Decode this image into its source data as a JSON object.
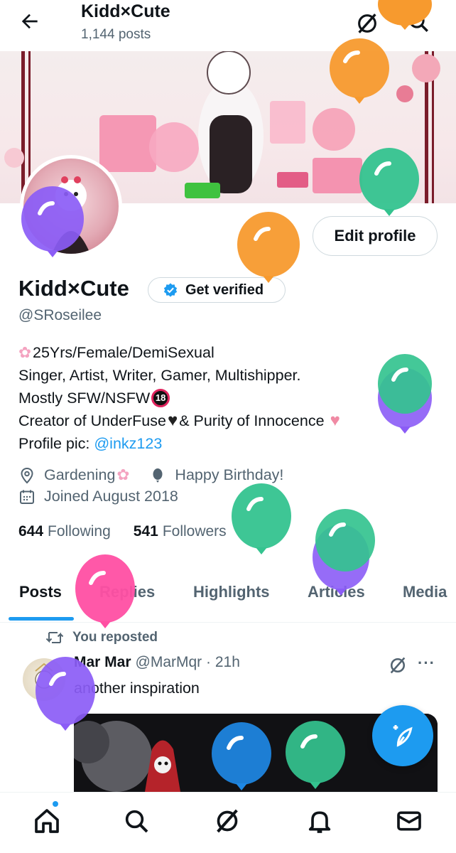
{
  "header": {
    "title": "Kidd×Cute",
    "post_count": "1,144 posts"
  },
  "profile": {
    "display_name": "Kidd×Cute",
    "handle": "@SRoseilee",
    "edit_profile_label": "Edit profile",
    "get_verified_label": "Get verified",
    "bio": {
      "line1": "25Yrs/Female/DemiSexual",
      "line2": "Singer, Artist, Writer, Gamer, Multishipper.",
      "line3": "Mostly SFW/NSFW",
      "line4_a": "Creator of UnderFuse",
      "line4_b": "& Purity of Innocence",
      "line5_prefix": "Profile pic: ",
      "line5_mention": "@inkz123"
    },
    "location": "Gardening",
    "birthday": "Happy Birthday!",
    "joined": "Joined August 2018",
    "following_count": "644",
    "following_label": "Following",
    "followers_count": "541",
    "followers_label": "Followers"
  },
  "tabs": [
    {
      "label": "Posts",
      "active": true
    },
    {
      "label": "Replies",
      "active": false
    },
    {
      "label": "Highlights",
      "active": false
    },
    {
      "label": "Articles",
      "active": false
    },
    {
      "label": "Media",
      "active": false
    }
  ],
  "post": {
    "repost_label": "You reposted",
    "author_name": "Mar Mar",
    "author_meta": "@MarMqr · 21h",
    "text": "another inspiration",
    "more_label": "···"
  },
  "colors": {
    "accent": "#1d9bf0",
    "text_primary": "#0f1419",
    "text_secondary": "#536471",
    "balloon_orange": "#f79a2e",
    "balloon_green": "#34c38f",
    "balloon_purple": "#8b5cf6",
    "balloon_pink": "#ff4fa3",
    "balloon_blue": "#1e88e5"
  },
  "icons": {
    "back": "arrow-left-icon",
    "grok": "grok-icon",
    "search": "search-icon",
    "verified": "verified-badge-icon",
    "location": "location-pin-icon",
    "birthday": "balloon-icon",
    "calendar": "calendar-icon",
    "repost": "repost-icon",
    "compose": "compose-post-icon",
    "home": "home-icon",
    "notifications": "bell-icon",
    "messages": "mail-icon"
  }
}
